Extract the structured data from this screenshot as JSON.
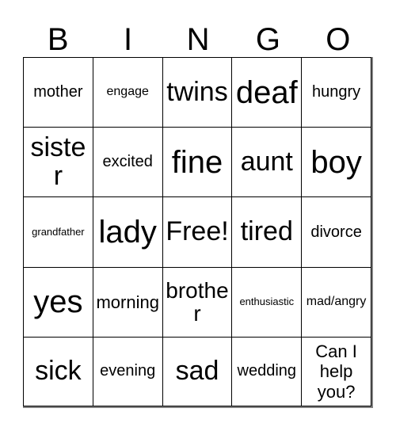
{
  "card": {
    "header_letters": [
      "B",
      "I",
      "N",
      "G",
      "O"
    ],
    "free_space_label": "Free!",
    "rows": [
      [
        {
          "label": "mother",
          "size": "md"
        },
        {
          "label": "engage",
          "size": "sm"
        },
        {
          "label": "twins",
          "size": "xxl"
        },
        {
          "label": "deaf",
          "size": "huge"
        },
        {
          "label": "hungry",
          "size": "md"
        }
      ],
      [
        {
          "label": "sister",
          "size": "xxl"
        },
        {
          "label": "excited",
          "size": "md"
        },
        {
          "label": "fine",
          "size": "huge"
        },
        {
          "label": "aunt",
          "size": "xxl"
        },
        {
          "label": "boy",
          "size": "huge"
        }
      ],
      [
        {
          "label": "grandfather",
          "size": "xs"
        },
        {
          "label": "lady",
          "size": "huge"
        },
        {
          "label": "Free!",
          "size": "xxl"
        },
        {
          "label": "tired",
          "size": "xxl"
        },
        {
          "label": "divorce",
          "size": "md"
        }
      ],
      [
        {
          "label": "yes",
          "size": "huge"
        },
        {
          "label": "morning",
          "size": "lg"
        },
        {
          "label": "brother",
          "size": "xl"
        },
        {
          "label": "enthusiastic",
          "size": "xs"
        },
        {
          "label": "mad/angry",
          "size": "sm"
        }
      ],
      [
        {
          "label": "sick",
          "size": "xxl"
        },
        {
          "label": "evening",
          "size": "md"
        },
        {
          "label": "sad",
          "size": "xxl"
        },
        {
          "label": "wedding",
          "size": "md"
        },
        {
          "label": "Can I help you?",
          "size": "lg",
          "multiline": true
        }
      ]
    ]
  },
  "colors": {
    "background": "#ffffff",
    "text": "#000000",
    "cell_border": "#000000",
    "outer_edge": "#808080"
  }
}
